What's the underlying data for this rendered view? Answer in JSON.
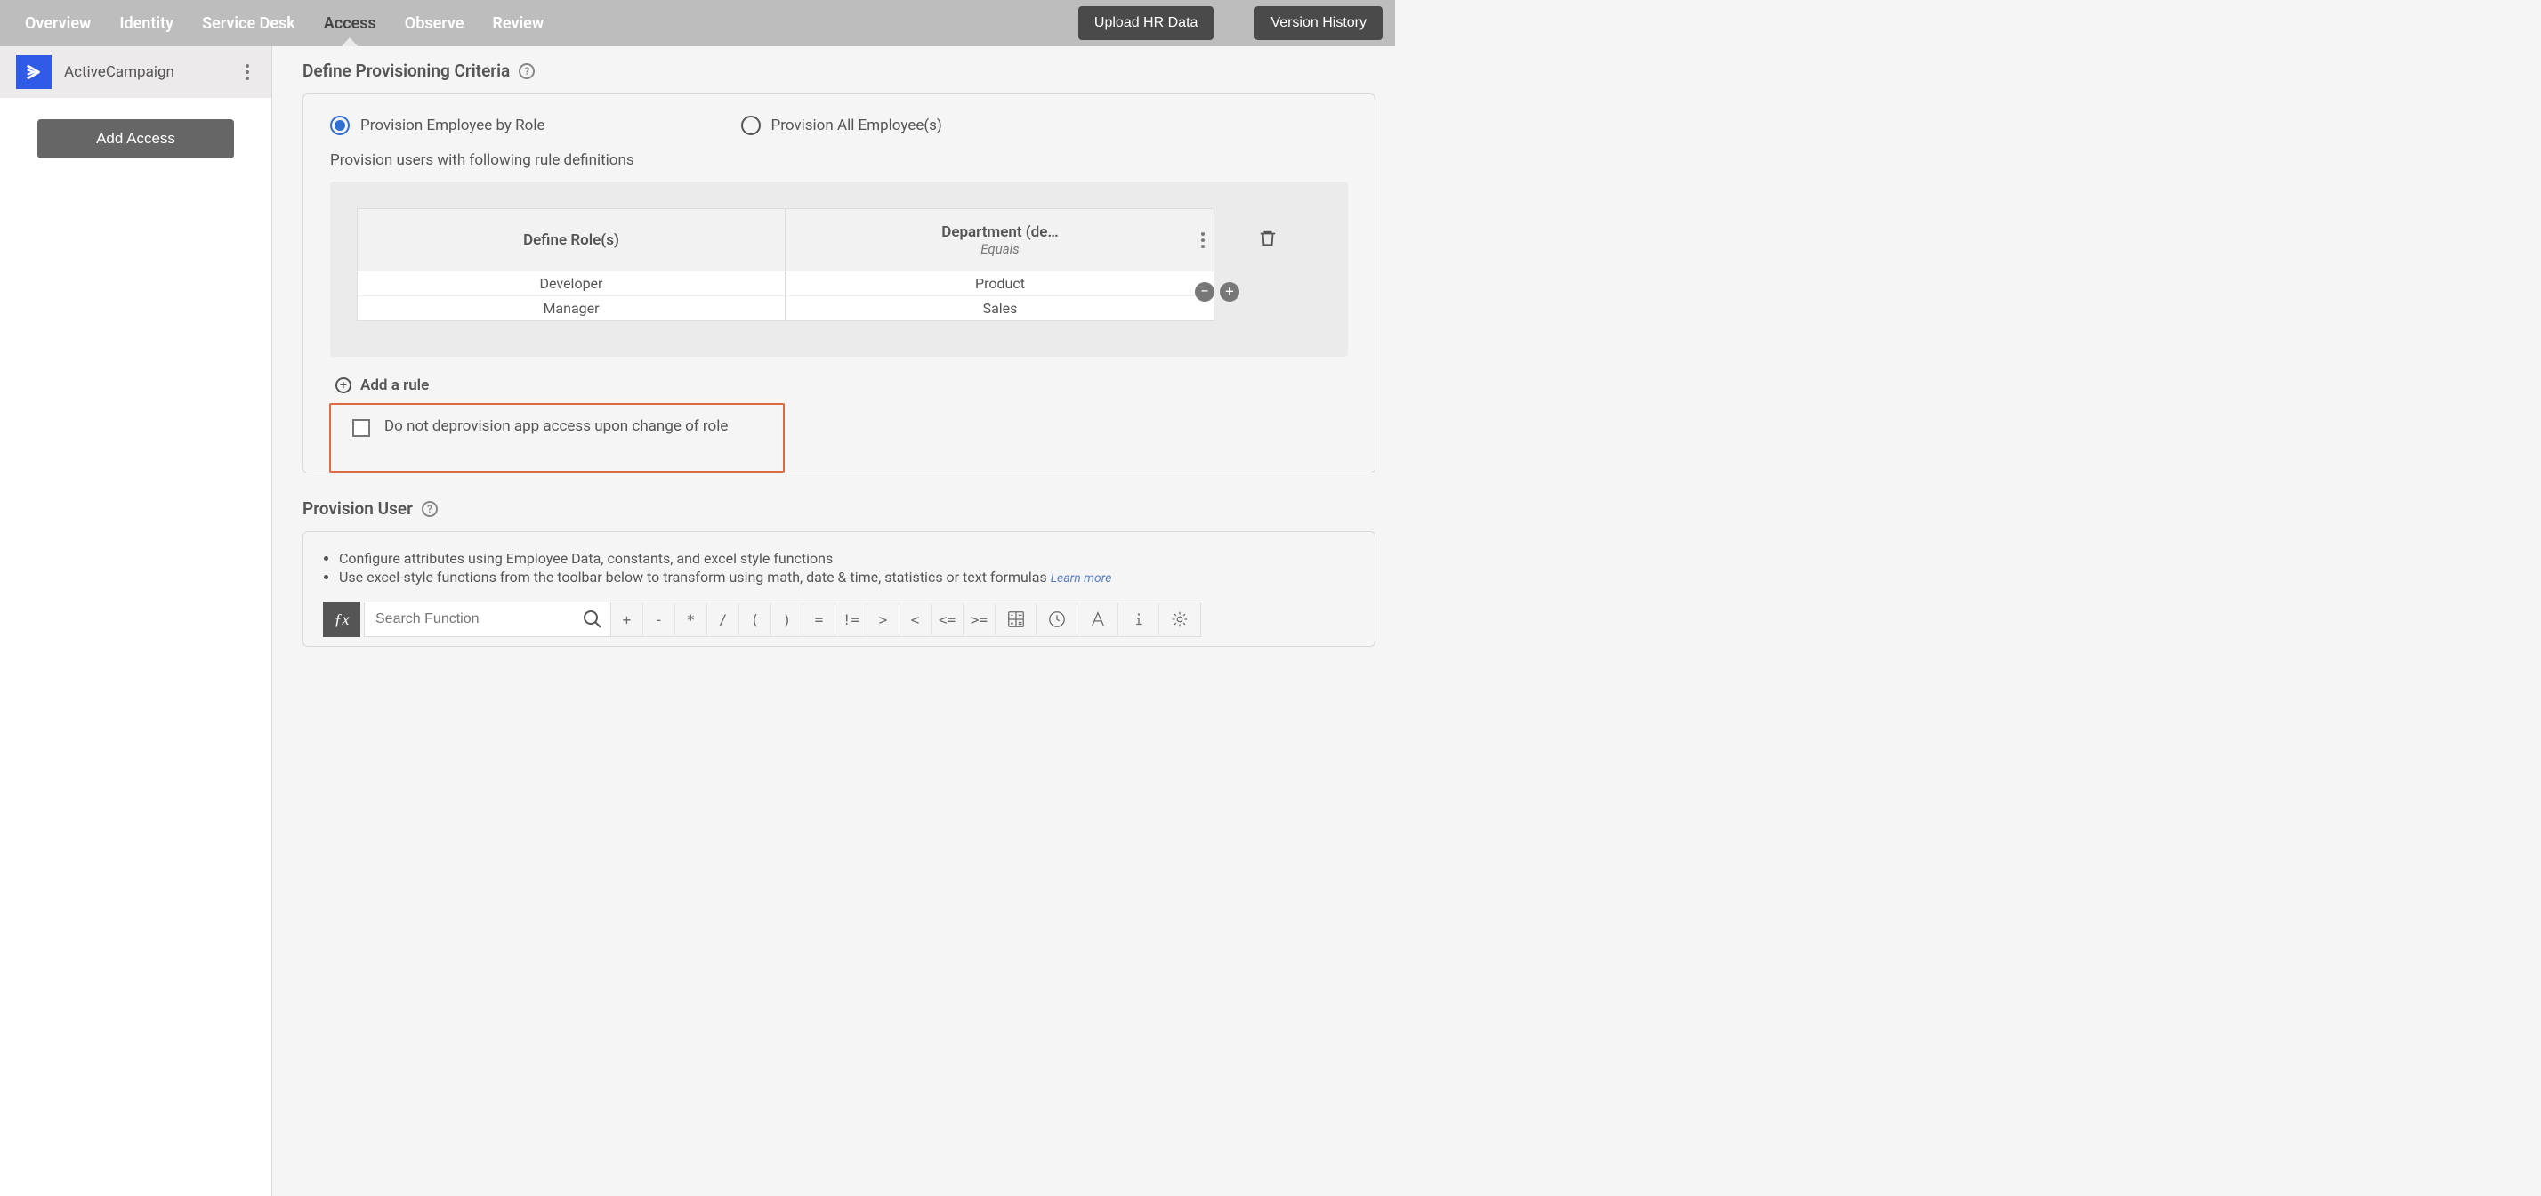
{
  "nav": {
    "tabs": [
      "Overview",
      "Identity",
      "Service Desk",
      "Access",
      "Observe",
      "Review"
    ],
    "active": "Access",
    "upload": "Upload HR Data",
    "version": "Version History"
  },
  "sidebar": {
    "app_name": "ActiveCampaign",
    "add_access": "Add Access"
  },
  "criteria": {
    "title": "Define Provisioning Criteria",
    "opt_by_role": "Provision Employee by Role",
    "opt_all": "Provision All Employee(s)",
    "selected": "by_role",
    "rule_caption": "Provision users with following rule definitions",
    "col1_title": "Define Role(s)",
    "col2_title": "Department (de…",
    "col2_sub": "Equals",
    "rows": [
      {
        "role": "Developer",
        "dept": "Product"
      },
      {
        "role": "Manager",
        "dept": "Sales"
      }
    ],
    "add_rule": "Add a rule",
    "checkbox_label": "Do not deprovision app access upon change of role"
  },
  "provision": {
    "title": "Provision User",
    "bullet1": "Configure attributes using Employee Data, constants, and excel style functions",
    "bullet2": "Use excel-style functions from the toolbar below to transform using math, date & time, statistics or text formulas",
    "learn_more": "Learn more",
    "search_placeholder": "Search Function",
    "ops": [
      "+",
      "-",
      "*",
      "/",
      "(",
      ")",
      "=",
      "!=",
      ">",
      "<",
      "<=",
      ">="
    ]
  }
}
